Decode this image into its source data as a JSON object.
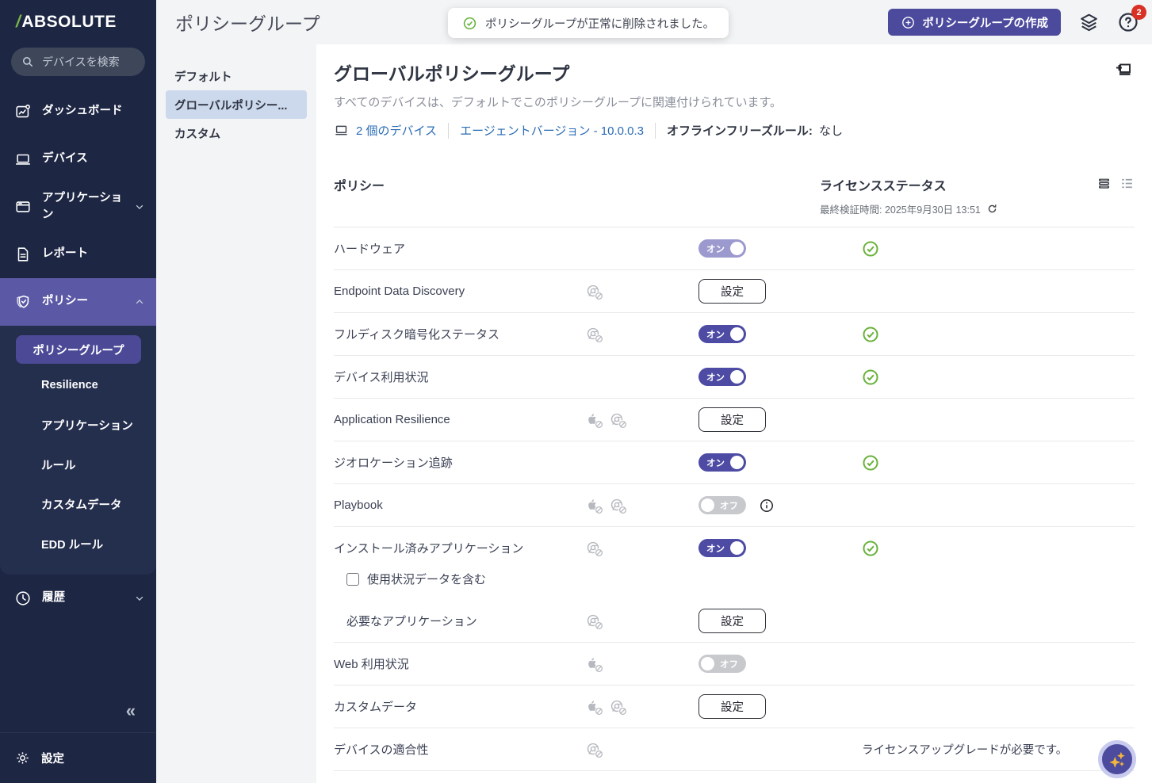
{
  "brand": {
    "slash": "/",
    "name": "ABSOLUTE"
  },
  "sidebar": {
    "search_placeholder": "デバイスを検索",
    "items": [
      {
        "name": "dashboard",
        "icon": "dashboard-icon",
        "label": "ダッシュボード"
      },
      {
        "name": "devices",
        "icon": "devices-icon",
        "label": "デバイス"
      },
      {
        "name": "applications",
        "icon": "applications-icon",
        "label": "アプリケーション",
        "chevron": "down"
      },
      {
        "name": "reports",
        "icon": "reports-icon",
        "label": "レポート"
      },
      {
        "name": "policies",
        "icon": "policies-icon",
        "label": "ポリシー",
        "chevron": "up",
        "active": true,
        "children": [
          {
            "name": "policy-groups",
            "label": "ポリシーグループ",
            "selected": true
          },
          {
            "name": "resilience",
            "label": "Resilience"
          },
          {
            "name": "applications",
            "label": "アプリケーション"
          },
          {
            "name": "rules",
            "label": "ルール"
          },
          {
            "name": "custom-data",
            "label": "カスタムデータ"
          },
          {
            "name": "edd-rules",
            "label": "EDD ルール"
          }
        ]
      },
      {
        "name": "history",
        "icon": "history-icon",
        "label": "履歴",
        "chevron": "down"
      }
    ],
    "collapse_glyph": "«",
    "settings_label": "設定"
  },
  "header": {
    "title": "ポリシーグループ",
    "create_label": "ポリシーグループの作成",
    "help_badge": "2"
  },
  "toast": {
    "message": "ポリシーグループが正常に削除されました。"
  },
  "groups_panel": {
    "items": [
      {
        "label": "デフォルト"
      },
      {
        "label": "グローバルポリシー...",
        "selected": true
      },
      {
        "label": "カスタム"
      }
    ]
  },
  "main": {
    "title": "グローバルポリシーグループ",
    "subtitle": "すべてのデバイスは、デフォルトでこのポリシーグループに関連付けられています。",
    "meta": {
      "devices": "2 個のデバイス",
      "agent": "エージェントバージョン - 10.0.0.3",
      "offline_label": "オフラインフリーズルール:",
      "offline_value": "なし"
    },
    "table": {
      "col_policy": "ポリシー",
      "col_license": "ライセンスステータス",
      "last_verified": "最終検証時間: 2025年9月30日 13:51",
      "rows": [
        {
          "label": "ハードウェア",
          "platforms": [],
          "control": "toggle-on-muted",
          "status": "ok"
        },
        {
          "label": "Endpoint Data Discovery",
          "platforms": [
            "chrome"
          ],
          "control": "configure"
        },
        {
          "label": "フルディスク暗号化ステータス",
          "platforms": [
            "chrome"
          ],
          "control": "toggle-on",
          "status": "ok"
        },
        {
          "label": "デバイス利用状況",
          "platforms": [],
          "control": "toggle-on",
          "status": "ok"
        },
        {
          "label": "Application Resilience",
          "platforms": [
            "apple",
            "chrome"
          ],
          "control": "configure"
        },
        {
          "label": "ジオロケーション追跡",
          "platforms": [],
          "control": "toggle-on",
          "status": "ok"
        },
        {
          "label": "Playbook",
          "platforms": [
            "apple",
            "chrome"
          ],
          "control": "toggle-off",
          "info": true
        },
        {
          "label": "インストール済みアプリケーション",
          "platforms": [
            "chrome"
          ],
          "control": "toggle-on",
          "status": "ok",
          "checkbox": {
            "label": "使用状況データを含む",
            "checked": false
          },
          "subrow": {
            "label": "必要なアプリケーション",
            "platforms": [
              "chrome"
            ],
            "control": "configure"
          }
        },
        {
          "label": "Web 利用状況",
          "platforms": [
            "apple"
          ],
          "control": "toggle-off"
        },
        {
          "label": "カスタムデータ",
          "platforms": [
            "apple",
            "chrome"
          ],
          "control": "configure"
        },
        {
          "label": "デバイスの適合性",
          "platforms": [
            "chrome"
          ],
          "control": "none",
          "license_text": "ライセンスアップグレードが必要です。"
        }
      ]
    }
  },
  "strings": {
    "on": "オン",
    "off": "オフ",
    "configure": "設定"
  },
  "colors": {
    "accent_purple": "#4c4a9d",
    "nav_active": "#5b59a6",
    "sidebar_bg": "#1d2643",
    "link_blue": "#2a6cb5",
    "success_green": "#6ab23c",
    "badge_red": "#d93025",
    "selected_group_bg": "#ccd8ec",
    "sparkle_gold": "#f1b43e"
  }
}
